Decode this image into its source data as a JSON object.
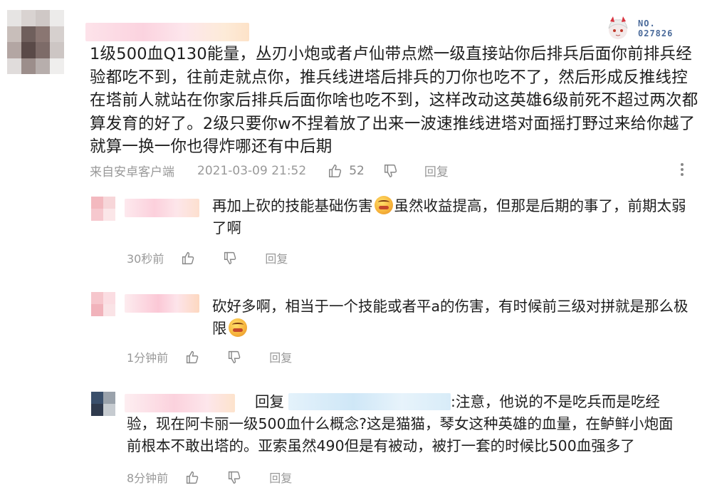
{
  "main_comment": {
    "text": "1级500血Q130能量，丛刃小炮或者卢仙带点燃一级直接站你后排兵后面你前排兵经验都吃不到，往前走就点你，推兵线进塔后排兵的刀你也吃不了，然后形成反推线控在塔前人就站在你家后排兵后面你啥也吃不到，这样改动这英雄6级前死不超过两次都算发育的好了。2级只要你w不捏着放了出来一波速推线进塔对面摇打野过来给你越了就算一换一你也得炸哪还有中后期",
    "source": "来自安卓客户端",
    "time": "2021-03-09 21:52",
    "likes": "52",
    "reply_label": "回复",
    "badge_no": "NO.",
    "badge_num": "027826"
  },
  "replies": [
    {
      "text_a": "再加上砍的技能基础伤害",
      "text_b": "虽然收益提高，但那是后期的事了，前期太弱了啊",
      "time": "30秒前",
      "reply_label": "回复"
    },
    {
      "text_a": "砍好多啊，相当于一个技能或者平a的伤害，有时候前三级对拼就是那么极限",
      "text_b": "",
      "time": "1分钟前",
      "reply_label": "回复"
    },
    {
      "prefix": "回复",
      "text_a": ":注意，他说的不是吃兵而是吃经验，现在阿卡丽一级500血什么概念?这是猫猫，琴女这种英雄的血量，在鲈鲜小炮面前根本不敢出塔的。亚索虽然490但是有被动，被打一套的时候比500血强多了",
      "time": "8分钟前",
      "reply_label": "回复"
    }
  ],
  "colors": {
    "meta": "#999999",
    "text": "#1e1e1e",
    "badge": "#4a6a9a"
  }
}
